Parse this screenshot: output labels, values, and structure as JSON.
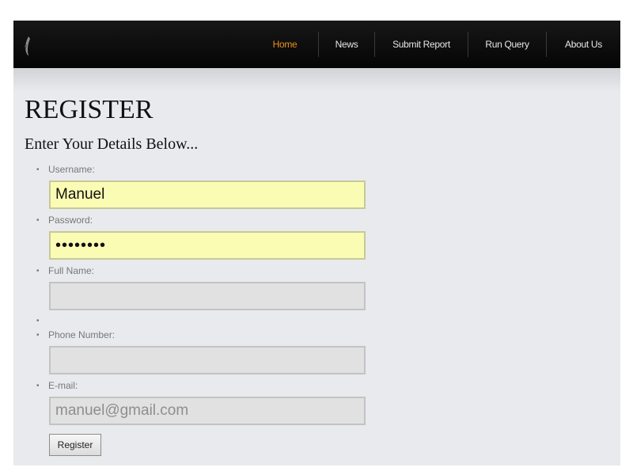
{
  "nav": {
    "items": [
      {
        "label": "Home",
        "active": true
      },
      {
        "label": "News",
        "active": false
      },
      {
        "label": "Submit Report",
        "active": false
      },
      {
        "label": "Run Query",
        "active": false
      },
      {
        "label": "About Us",
        "active": false
      }
    ]
  },
  "page": {
    "title": "REGISTER",
    "subtitle": "Enter Your Details Below..."
  },
  "form": {
    "username": {
      "label": "Username:",
      "value": "Manuel"
    },
    "password": {
      "label": "Password:",
      "value": "12345678"
    },
    "full_name": {
      "label": "Full Name:",
      "value": ""
    },
    "empty_item_bullet": "•",
    "phone": {
      "label": "Phone Number:",
      "value": ""
    },
    "email": {
      "label": "E-mail:",
      "value": "manuel@gmail.com"
    },
    "register_label": "Register"
  },
  "colors": {
    "nav_active": "#e8901e",
    "autofill_background": "#fbfcb4",
    "page_background": "#e9eaee"
  },
  "bullet": "•"
}
